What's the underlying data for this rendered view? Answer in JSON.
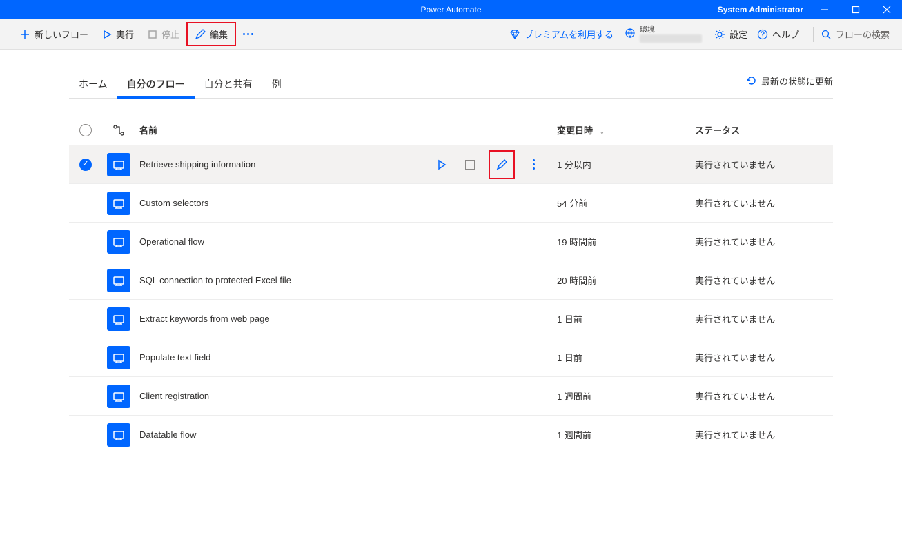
{
  "titlebar": {
    "app_title": "Power Automate",
    "user": "System Administrator"
  },
  "toolbar": {
    "new_flow": "新しいフロー",
    "run": "実行",
    "stop": "停止",
    "edit": "編集",
    "premium": "プレミアムを利用する",
    "env_label": "環境",
    "settings": "設定",
    "help": "ヘルプ",
    "search_placeholder": "フローの検索"
  },
  "tabs": {
    "home": "ホーム",
    "my_flows": "自分のフロー",
    "shared": "自分と共有",
    "examples": "例"
  },
  "refresh_label": "最新の状態に更新",
  "columns": {
    "name": "名前",
    "modified": "変更日時",
    "status": "ステータス"
  },
  "flows": [
    {
      "name": "Retrieve shipping information",
      "modified": "1 分以内",
      "status": "実行されていません",
      "selected": true
    },
    {
      "name": "Custom selectors",
      "modified": "54 分前",
      "status": "実行されていません",
      "selected": false
    },
    {
      "name": "Operational flow",
      "modified": "19 時間前",
      "status": "実行されていません",
      "selected": false
    },
    {
      "name": "SQL connection to protected Excel file",
      "modified": "20 時間前",
      "status": "実行されていません",
      "selected": false
    },
    {
      "name": "Extract keywords from web page",
      "modified": "1 日前",
      "status": "実行されていません",
      "selected": false
    },
    {
      "name": "Populate text field",
      "modified": "1 日前",
      "status": "実行されていません",
      "selected": false
    },
    {
      "name": "Client registration",
      "modified": "1 週間前",
      "status": "実行されていません",
      "selected": false
    },
    {
      "name": "Datatable flow",
      "modified": "1 週間前",
      "status": "実行されていません",
      "selected": false
    }
  ]
}
